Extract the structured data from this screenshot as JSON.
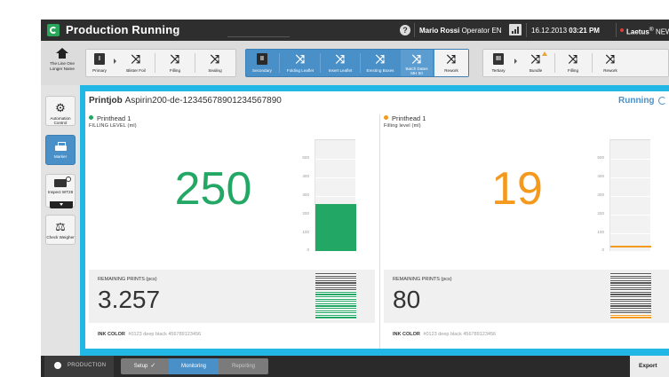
{
  "titlebar": {
    "title": "Production Running",
    "help_label": "?",
    "user": "Mario Rossi",
    "role": "Operator",
    "lang": "EN",
    "date": "16.12.2013",
    "time": "03:21 PM",
    "brand": "Laetus",
    "brand_sup": "®",
    "brand_suffix": "NEW TECHNOLOGIES"
  },
  "toolbar": {
    "home_label": "The Line One Longer Name",
    "primary": {
      "tile": "I",
      "label": "Primary"
    },
    "blister": "Blister Foil",
    "filling1": "Filling",
    "sealing": "Sealing",
    "secondary": {
      "tile": "II",
      "label": "Secondary"
    },
    "folding": "Folding Leaflet",
    "insert": "Insert Leaflet",
    "erecting": "Erecting Boxes",
    "batch": {
      "label": "Batch Dates",
      "sub": "MH 50"
    },
    "rework1": "Rework",
    "tertiary": {
      "tile": "III",
      "label": "Tertiary"
    },
    "bundle": "Bundle",
    "filling2": "Filling",
    "rework2": "Rework",
    "shuffle_glyph": "⤨"
  },
  "leftnav": {
    "automation": "Automation Control",
    "marker": "Marker",
    "inspect": "Inspect WT28",
    "weigher": "Check Weigher",
    "gear_glyph": "⚙",
    "scale_glyph": "⚖"
  },
  "job": {
    "label": "Printjob",
    "id": "Aspirin200-de-12345678901234567890",
    "status": "Running"
  },
  "printheads": [
    {
      "name": "Printhead 1",
      "level_label": "FILLING LEVEL (ml)",
      "level": 250,
      "color": "#22a864",
      "remaining_label": "REMAINING PRINTS (pcs)",
      "remaining": "3.257",
      "ink_label": "INK COLOR",
      "ink_value": "#0123 deep black 456789123456"
    },
    {
      "name": "Printhead 1",
      "level_label": "Filling level (ml)",
      "level": 19,
      "color": "#f39a1e",
      "remaining_label": "REMAINING PRINTS (pcs)",
      "remaining": "80",
      "ink_label": "INK COLOR",
      "ink_value": "#0123 deep black 456789123456"
    }
  ],
  "gauge": {
    "max": 600,
    "ticks": [
      "500",
      "400",
      "300",
      "200",
      "100",
      "0"
    ]
  },
  "bottombar": {
    "production": "PRODUCTION",
    "setup": "Setup",
    "monitoring": "Monitoring",
    "reporting": "Reporting",
    "export": "Export",
    "check_glyph": "✓"
  },
  "colors": {
    "accent": "#4a90c8",
    "frame": "#22b8e6",
    "green": "#22a864",
    "orange": "#f39a1e"
  }
}
